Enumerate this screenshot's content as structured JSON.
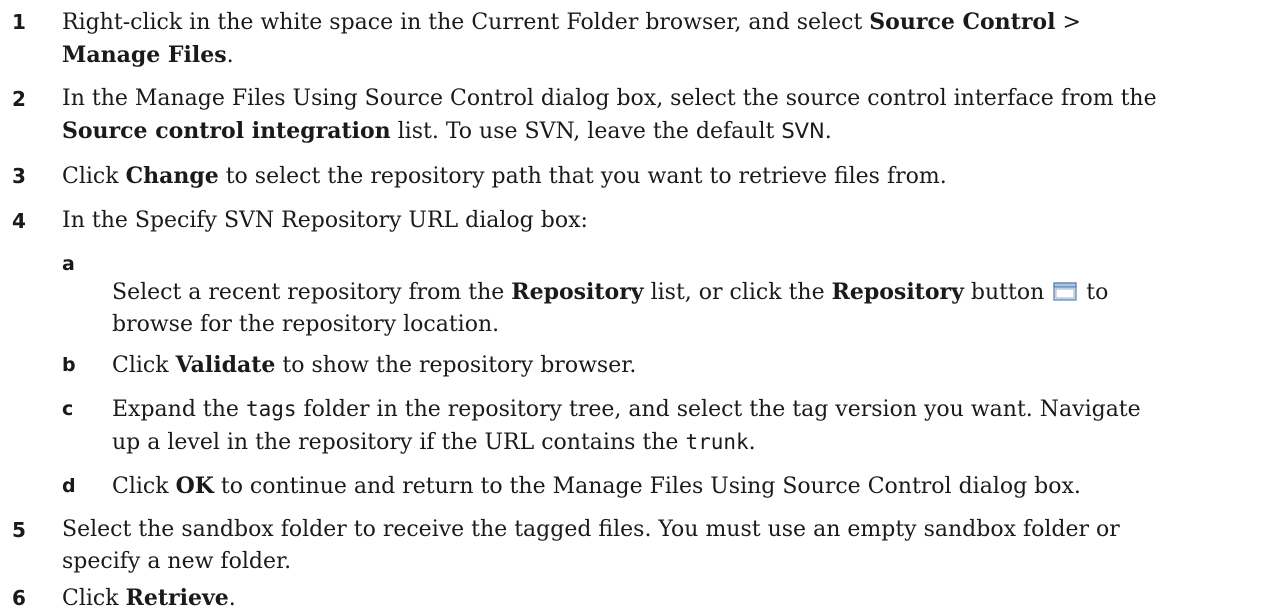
{
  "steps": [
    {
      "num": "1",
      "t1": "Right-click in the white space in the Current Folder browser, and select ",
      "b1": "Source Control",
      "t2": " >",
      "b2": "Manage Files",
      "t3": "."
    },
    {
      "num": "2",
      "t1": "In the Manage Files Using Source Control dialog box, select the source control interface from the",
      "b1": "Source control integration",
      "t2": " list. To use SVN, leave the default ",
      "c1": "SVN",
      "t3": "."
    },
    {
      "num": "3",
      "t1": "Click ",
      "b1": "Change",
      "t2": " to select the repository path that you want to retrieve files from."
    },
    {
      "num": "4",
      "t1": "In the Specify SVN Repository URL dialog box:"
    },
    {
      "num": "5",
      "t1": "Select the sandbox folder to receive the tagged files. You must use an empty sandbox folder or",
      "t2": "specify a new folder."
    },
    {
      "num": "6",
      "t1": "Click ",
      "b1": "Retrieve",
      "t2": "."
    }
  ],
  "substeps": [
    {
      "num": "a",
      "t1": "Select a recent repository from the ",
      "b1": "Repository",
      "t2": " list, or click the ",
      "b2": "Repository",
      "t3": " button ",
      "t4": " to",
      "t5": "browse for the repository location.",
      "icon": "folder-icon"
    },
    {
      "num": "b",
      "t1": "Click ",
      "b1": "Validate",
      "t2": " to show the repository browser."
    },
    {
      "num": "c",
      "t1": "Expand the ",
      "c1": "tags",
      "t2": " folder in the repository tree, and select the tag version you want. Navigate",
      "t3": "up a level in the repository if the URL contains the ",
      "c2": "trunk",
      "t4": "."
    },
    {
      "num": "d",
      "t1": "Click ",
      "b1": "OK",
      "t2": " to continue and return to the Manage Files Using Source Control dialog box."
    }
  ]
}
